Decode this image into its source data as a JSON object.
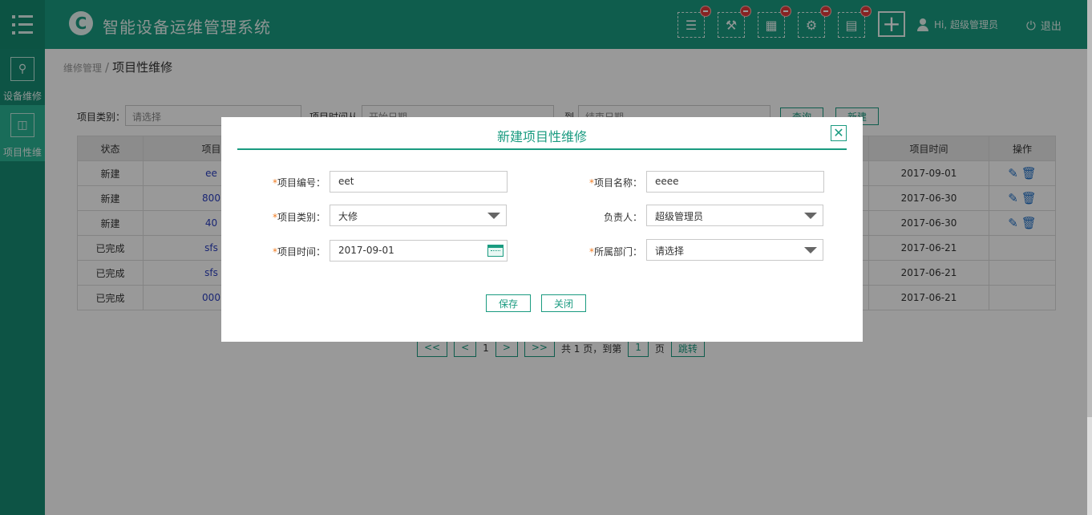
{
  "app": {
    "title": "智能设备运维管理系统",
    "logo_letter": "C"
  },
  "header": {
    "tool_icons": [
      "list-icon",
      "engineer-icon",
      "calendar-icon",
      "search-gear-icon",
      "document-icon"
    ],
    "add_label": "+",
    "user_label": "Hi, 超级管理员",
    "logout_label": "退出"
  },
  "sidebar": {
    "items": [
      {
        "label": "设备维修",
        "icon": "wrench-icon"
      },
      {
        "label": "项目性维",
        "icon": "project-icon"
      }
    ]
  },
  "breadcrumb": {
    "parent": "维修管理",
    "current": "项目性维修"
  },
  "filters": {
    "category_label": "项目类别：",
    "category_value": "请选择",
    "time_label": "项目时间从",
    "start_placeholder": "开始日期",
    "to_label": "到",
    "end_placeholder": "结束日期",
    "query_label": "查询",
    "new_label": "新建"
  },
  "table": {
    "columns": [
      "状态",
      "项目",
      "项目时间",
      "操作"
    ],
    "rows": [
      {
        "status": "新建",
        "code": "ee",
        "time": "2017-09-01",
        "editable": true
      },
      {
        "status": "新建",
        "code": "800",
        "time": "2017-06-30",
        "editable": true
      },
      {
        "status": "新建",
        "code": "40",
        "time": "2017-06-30",
        "editable": true
      },
      {
        "status": "已完成",
        "code": "sfs",
        "time": "2017-06-21",
        "editable": false
      },
      {
        "status": "已完成",
        "code": "sfs",
        "time": "2017-06-21",
        "editable": false
      },
      {
        "status": "已完成",
        "code": "000",
        "time": "2017-06-21",
        "editable": false
      }
    ]
  },
  "pager": {
    "first": "<<",
    "prev": "<",
    "current": "1",
    "next": ">",
    "last": ">>",
    "total_text": "共 1 页，到第",
    "goto_value": "1",
    "page_unit": "页",
    "jump_label": "跳转"
  },
  "modal": {
    "title": "新建项目性维修",
    "close": "✕",
    "fields": {
      "code_label": "项目编号：",
      "code_value": "eet",
      "name_label": "项目名称：",
      "name_value": "eeee",
      "category_label": "项目类别：",
      "category_value": "大修",
      "owner_label": "负责人：",
      "owner_value": "超级管理员",
      "time_label": "项目时间：",
      "time_value": "2017-09-01",
      "dept_label": "所属部门：",
      "dept_value": "请选择"
    },
    "save_label": "保存",
    "close_label": "关闭"
  },
  "colors": {
    "brand": "#1a9b80",
    "required": "#f07c22",
    "link": "#2a3fc0",
    "badge": "#e23b3b"
  }
}
